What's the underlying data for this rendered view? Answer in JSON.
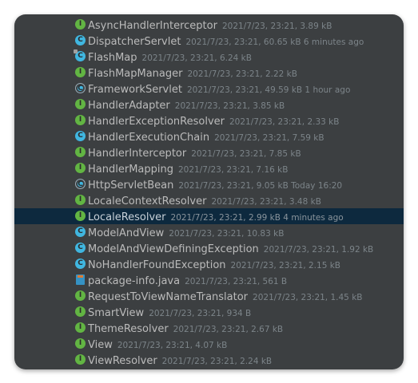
{
  "files": [
    {
      "name": "AsyncHandlerInterceptor",
      "meta": "2021/7/23, 23:21, 3.89 kB",
      "icon": "interface-icon",
      "kind": "interface",
      "glyph": "I"
    },
    {
      "name": "DispatcherServlet",
      "meta": "2021/7/23, 23:21, 60.65 kB 6 minutes ago",
      "icon": "class-icon",
      "kind": "class",
      "glyph": "C"
    },
    {
      "name": "FlashMap",
      "meta": "2021/7/23, 23:21, 6.24 kB",
      "icon": "class-modified-icon",
      "kind": "class-modified",
      "glyph": "C"
    },
    {
      "name": "FlashMapManager",
      "meta": "2021/7/23, 23:21, 2.22 kB",
      "icon": "interface-icon",
      "kind": "interface",
      "glyph": "I"
    },
    {
      "name": "FrameworkServlet",
      "meta": "2021/7/23, 23:21, 49.59 kB 1 hour ago",
      "icon": "abstract-class-icon",
      "kind": "class-abstract",
      "glyph": "C"
    },
    {
      "name": "HandlerAdapter",
      "meta": "2021/7/23, 23:21, 3.85 kB",
      "icon": "interface-icon",
      "kind": "interface",
      "glyph": "I"
    },
    {
      "name": "HandlerExceptionResolver",
      "meta": "2021/7/23, 23:21, 2.33 kB",
      "icon": "interface-icon",
      "kind": "interface",
      "glyph": "I"
    },
    {
      "name": "HandlerExecutionChain",
      "meta": "2021/7/23, 23:21, 7.59 kB",
      "icon": "class-icon",
      "kind": "class",
      "glyph": "C"
    },
    {
      "name": "HandlerInterceptor",
      "meta": "2021/7/23, 23:21, 7.85 kB",
      "icon": "interface-icon",
      "kind": "interface",
      "glyph": "I"
    },
    {
      "name": "HandlerMapping",
      "meta": "2021/7/23, 23:21, 7.16 kB",
      "icon": "interface-icon",
      "kind": "interface",
      "glyph": "I"
    },
    {
      "name": "HttpServletBean",
      "meta": "2021/7/23, 23:21, 9.05 kB Today 16:20",
      "icon": "abstract-class-icon",
      "kind": "class-abstract",
      "glyph": "C"
    },
    {
      "name": "LocaleContextResolver",
      "meta": "2021/7/23, 23:21, 3.48 kB",
      "icon": "interface-icon",
      "kind": "interface",
      "glyph": "I"
    },
    {
      "name": "LocaleResolver",
      "meta": "2021/7/23, 23:21, 2.99 kB 4 minutes ago",
      "icon": "interface-icon",
      "kind": "interface",
      "glyph": "I",
      "selected": true
    },
    {
      "name": "ModelAndView",
      "meta": "2021/7/23, 23:21, 10.83 kB",
      "icon": "class-icon",
      "kind": "class",
      "glyph": "C"
    },
    {
      "name": "ModelAndViewDefiningException",
      "meta": "2021/7/23, 23:21, 1.92 kB",
      "icon": "class-icon",
      "kind": "class",
      "glyph": "C"
    },
    {
      "name": "NoHandlerFoundException",
      "meta": "2021/7/23, 23:21, 2.15 kB",
      "icon": "class-icon",
      "kind": "class",
      "glyph": "C"
    },
    {
      "name": "package-info.java",
      "meta": "2021/7/23, 23:21, 561 B",
      "icon": "java-file-icon",
      "kind": "java-file",
      "glyph": ""
    },
    {
      "name": "RequestToViewNameTranslator",
      "meta": "2021/7/23, 23:21, 1.45 kB",
      "icon": "interface-icon",
      "kind": "interface",
      "glyph": "I"
    },
    {
      "name": "SmartView",
      "meta": "2021/7/23, 23:21, 934 B",
      "icon": "interface-icon",
      "kind": "interface",
      "glyph": "I"
    },
    {
      "name": "ThemeResolver",
      "meta": "2021/7/23, 23:21, 2.67 kB",
      "icon": "interface-icon",
      "kind": "interface",
      "glyph": "I"
    },
    {
      "name": "View",
      "meta": "2021/7/23, 23:21, 4.07 kB",
      "icon": "interface-icon",
      "kind": "interface",
      "glyph": "I"
    },
    {
      "name": "ViewResolver",
      "meta": "2021/7/23, 23:21, 2.24 kB",
      "icon": "interface-icon",
      "kind": "interface",
      "glyph": "I"
    }
  ],
  "colors": {
    "panel_bg": "#3c3f41",
    "selection_bg": "#0d293e",
    "interface_icon": "#62b543",
    "class_icon": "#40b6e0",
    "name_text": "#bbbbbb",
    "meta_text": "#7c8489"
  }
}
